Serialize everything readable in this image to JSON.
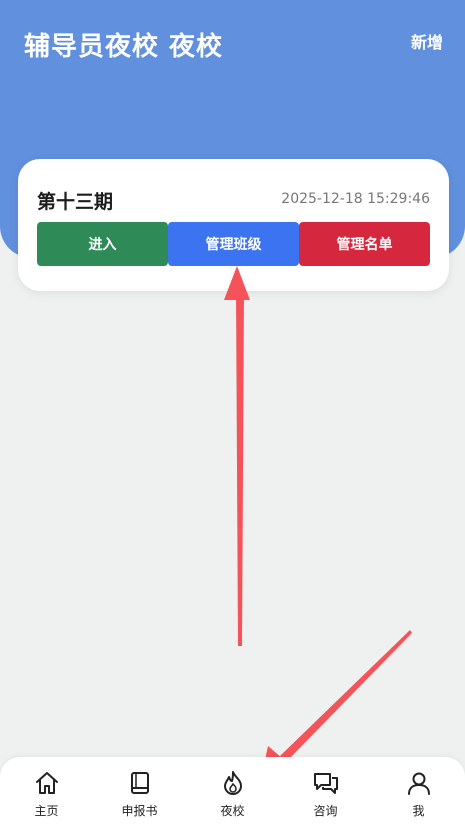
{
  "header": {
    "title": "辅导员夜校 夜校",
    "add_label": "新增",
    "background_color": "#6190df"
  },
  "term_card": {
    "name": "第十三期",
    "timestamp": "2025-12-18 15:29:46",
    "buttons": {
      "enter": {
        "label": "进入",
        "color": "#2e8a57"
      },
      "manage_class": {
        "label": "管理班级",
        "color": "#3b73f0"
      },
      "manage_roster": {
        "label": "管理名单",
        "color": "#d5283f"
      }
    }
  },
  "tabbar": {
    "items": [
      {
        "label": "主页",
        "icon": "home-icon"
      },
      {
        "label": "申报书",
        "icon": "book-icon"
      },
      {
        "label": "夜校",
        "icon": "flame-icon",
        "active": true
      },
      {
        "label": "咨询",
        "icon": "chat-icon"
      },
      {
        "label": "我",
        "icon": "user-icon"
      }
    ]
  },
  "annotations": {
    "arrow_color": "#f4535a"
  }
}
